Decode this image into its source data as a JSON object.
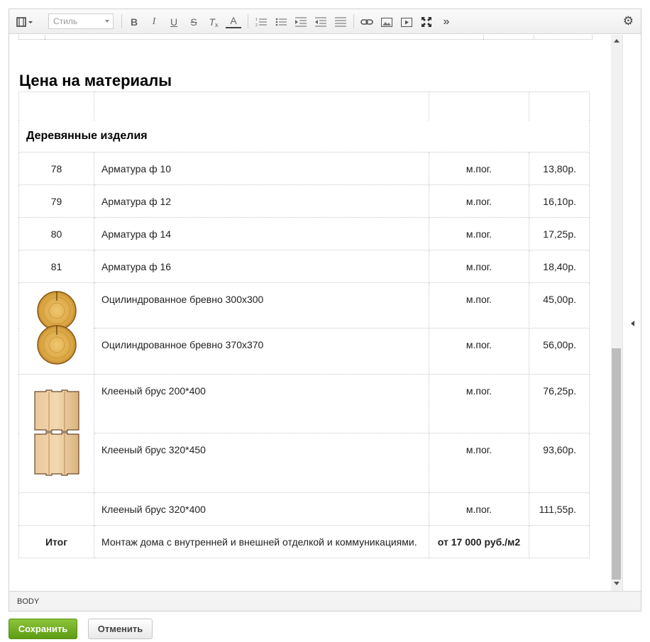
{
  "toolbar": {
    "style_placeholder": "Стиль",
    "icons": [
      "mode-icon",
      "bold-icon",
      "italic-icon",
      "underline-icon",
      "strike-icon",
      "clear-format-icon",
      "font-color-icon",
      "ordered-list-icon",
      "unordered-list-icon",
      "indent-icon",
      "outdent-icon",
      "align-icon",
      "link-icon",
      "image-icon",
      "video-icon",
      "fullscreen-icon",
      "more-icon",
      "settings-icon"
    ]
  },
  "content": {
    "title": "Цена на материалы",
    "section_title": "Деревянные изделия",
    "rows": [
      {
        "num": "78",
        "name": "Арматура ф 10",
        "unit": "м.пог.",
        "price": "13,80р."
      },
      {
        "num": "79",
        "name": "Арматура ф 12",
        "unit": "м.пог.",
        "price": "16,10р."
      },
      {
        "num": "80",
        "name": "Арматура ф 14",
        "unit": "м.пог.",
        "price": "17,25р."
      },
      {
        "num": "81",
        "name": "Арматура ф 16",
        "unit": "м.пог.",
        "price": "18,40р."
      },
      {
        "num": "",
        "name": "Оцилиндрованное бревно 300х300",
        "unit": "м.пог.",
        "price": "45,00р."
      },
      {
        "num": "",
        "name": "Оцилиндрованное бревно 370х370",
        "unit": "м.пог.",
        "price": "56,00р."
      },
      {
        "num": "",
        "name": "Клееный брус 200*400",
        "unit": "м.пог.",
        "price": "76,25р."
      },
      {
        "num": "",
        "name": "Клееный брус 320*450",
        "unit": "м.пог.",
        "price": "93,60р."
      },
      {
        "num": "",
        "name": "Клееный брус 320*400",
        "unit": "м.пог.",
        "price": "111,55р."
      }
    ],
    "total": {
      "label": "Итог",
      "name": "Монтаж дома с внутренней и внешней отделкой и коммуникациями.",
      "unit": "от 17 000 руб./м2",
      "price": ""
    }
  },
  "statusbar": {
    "path": "BODY"
  },
  "buttons": {
    "save": "Сохранить",
    "cancel": "Отменить"
  },
  "colors": {
    "save_bg": "#6aaa1e",
    "accent": "#5d9c13",
    "border": "#c8c8c8"
  }
}
